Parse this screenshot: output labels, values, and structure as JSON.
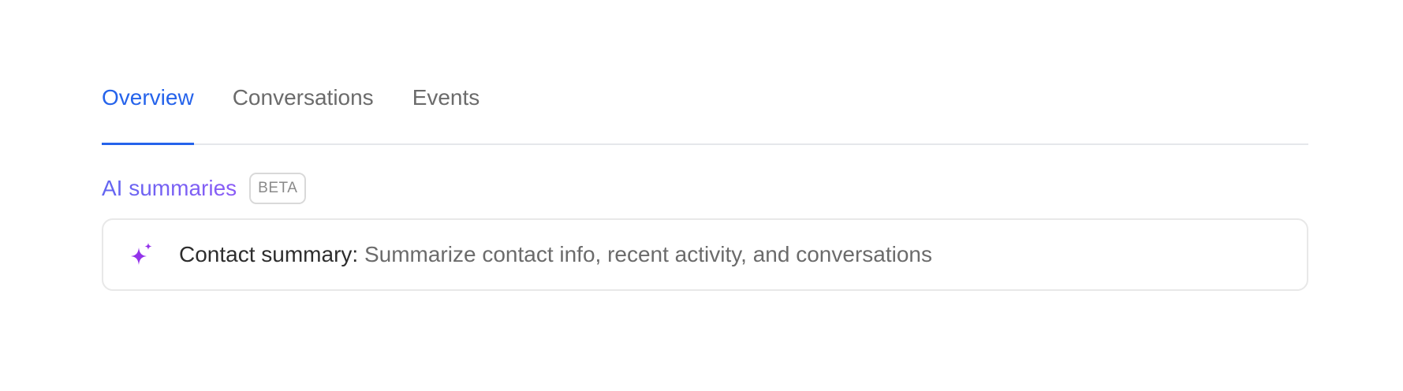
{
  "tabs": [
    {
      "label": "Overview",
      "active": true
    },
    {
      "label": "Conversations",
      "active": false
    },
    {
      "label": "Events",
      "active": false
    }
  ],
  "ai_summaries": {
    "title": "AI summaries",
    "badge": "BETA",
    "card": {
      "icon": "sparkle-icon",
      "label": "Contact summary:",
      "description": "Summarize contact info, recent activity, and conversations"
    }
  },
  "colors": {
    "accent": "#2563eb",
    "ai_gradient_start": "#6366f1",
    "ai_gradient_end": "#8b5cf6",
    "sparkle": "#9333ea",
    "muted_text": "#6b6b6b",
    "border": "#e8e8e8"
  }
}
